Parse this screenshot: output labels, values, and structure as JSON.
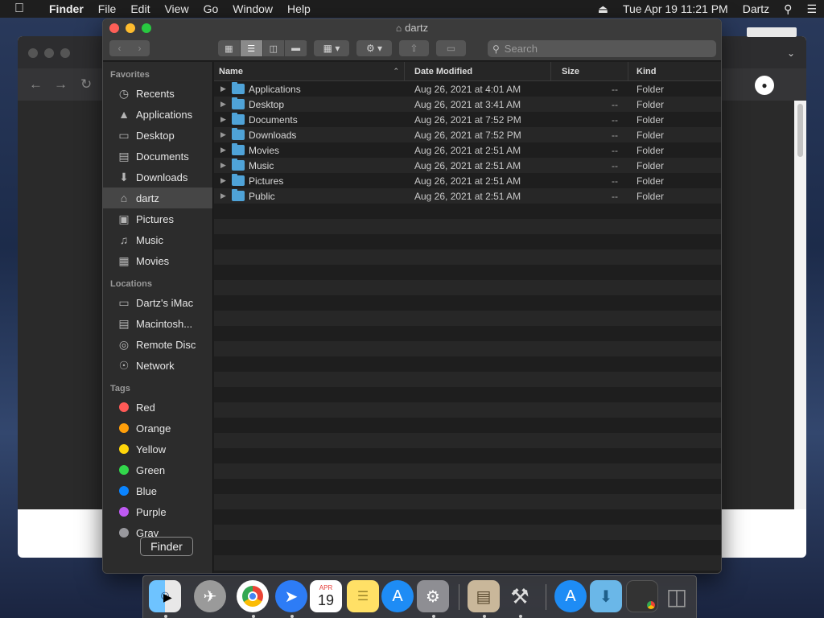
{
  "menubar": {
    "app_name": "Finder",
    "items": [
      "File",
      "Edit",
      "View",
      "Go",
      "Window",
      "Help"
    ],
    "datetime": "Tue Apr 19  11:21 PM",
    "user": "Dartz"
  },
  "window": {
    "title": "dartz",
    "search_placeholder": "Search"
  },
  "sidebar": {
    "favorites_heading": "Favorites",
    "favorites": [
      {
        "label": "Recents",
        "icon": "clock-icon"
      },
      {
        "label": "Applications",
        "icon": "applications-icon"
      },
      {
        "label": "Desktop",
        "icon": "desktop-icon"
      },
      {
        "label": "Documents",
        "icon": "document-icon"
      },
      {
        "label": "Downloads",
        "icon": "download-icon"
      },
      {
        "label": "dartz",
        "icon": "home-icon"
      },
      {
        "label": "Pictures",
        "icon": "camera-icon"
      },
      {
        "label": "Music",
        "icon": "music-note-icon"
      },
      {
        "label": "Movies",
        "icon": "film-icon"
      }
    ],
    "locations_heading": "Locations",
    "locations": [
      {
        "label": "Dartz's iMac",
        "icon": "imac-icon"
      },
      {
        "label": "Macintosh...",
        "icon": "disk-icon"
      },
      {
        "label": "Remote Disc",
        "icon": "disc-icon"
      },
      {
        "label": "Network",
        "icon": "globe-icon"
      }
    ],
    "tags_heading": "Tags",
    "tags": [
      {
        "label": "Red",
        "color": "#ff5a57"
      },
      {
        "label": "Orange",
        "color": "#ff9f0a"
      },
      {
        "label": "Yellow",
        "color": "#ffd60a"
      },
      {
        "label": "Green",
        "color": "#32d74b"
      },
      {
        "label": "Blue",
        "color": "#0a84ff"
      },
      {
        "label": "Purple",
        "color": "#bf5af2"
      },
      {
        "label": "Gray",
        "color": "#98989d"
      }
    ]
  },
  "columns": {
    "name": "Name",
    "date": "Date Modified",
    "size": "Size",
    "kind": "Kind"
  },
  "files": [
    {
      "name": "Applications",
      "date": "Aug 26, 2021 at 4:01 AM",
      "size": "--",
      "kind": "Folder"
    },
    {
      "name": "Desktop",
      "date": "Aug 26, 2021 at 3:41 AM",
      "size": "--",
      "kind": "Folder"
    },
    {
      "name": "Documents",
      "date": "Aug 26, 2021 at 7:52 PM",
      "size": "--",
      "kind": "Folder"
    },
    {
      "name": "Downloads",
      "date": "Aug 26, 2021 at 7:52 PM",
      "size": "--",
      "kind": "Folder"
    },
    {
      "name": "Movies",
      "date": "Aug 26, 2021 at 2:51 AM",
      "size": "--",
      "kind": "Folder"
    },
    {
      "name": "Music",
      "date": "Aug 26, 2021 at 2:51 AM",
      "size": "--",
      "kind": "Folder"
    },
    {
      "name": "Pictures",
      "date": "Aug 26, 2021 at 2:51 AM",
      "size": "--",
      "kind": "Folder"
    },
    {
      "name": "Public",
      "date": "Aug 26, 2021 at 2:51 AM",
      "size": "--",
      "kind": "Folder"
    }
  ],
  "tooltip": "Finder",
  "dock": {
    "calendar_month": "APR",
    "calendar_day": "19",
    "apps": [
      {
        "name": "finder-icon",
        "color": "#3b8fe0"
      },
      {
        "name": "launchpad-icon",
        "color": "#8a8a8a"
      },
      {
        "name": "chrome-icon",
        "color": "#e8e8e8"
      },
      {
        "name": "safari-icon",
        "color": "#2d7cf6"
      },
      {
        "name": "calendar-icon",
        "color": "#ffffff"
      },
      {
        "name": "notes-icon",
        "color": "#ffe066"
      },
      {
        "name": "app-store-icon",
        "color": "#1e8cf5"
      },
      {
        "name": "system-preferences-icon",
        "color": "#8e8e93"
      },
      {
        "name": "archive-utility-icon",
        "color": "#c9b79a"
      },
      {
        "name": "tools-icon",
        "color": "#555"
      },
      {
        "name": "downloads-stack-icon",
        "color": "#1e8cf5"
      },
      {
        "name": "folder-stack-icon",
        "color": "#6ab7e8"
      },
      {
        "name": "window-stack-icon",
        "color": "#333"
      },
      {
        "name": "trash-icon",
        "color": "#6b6b6b"
      }
    ]
  }
}
